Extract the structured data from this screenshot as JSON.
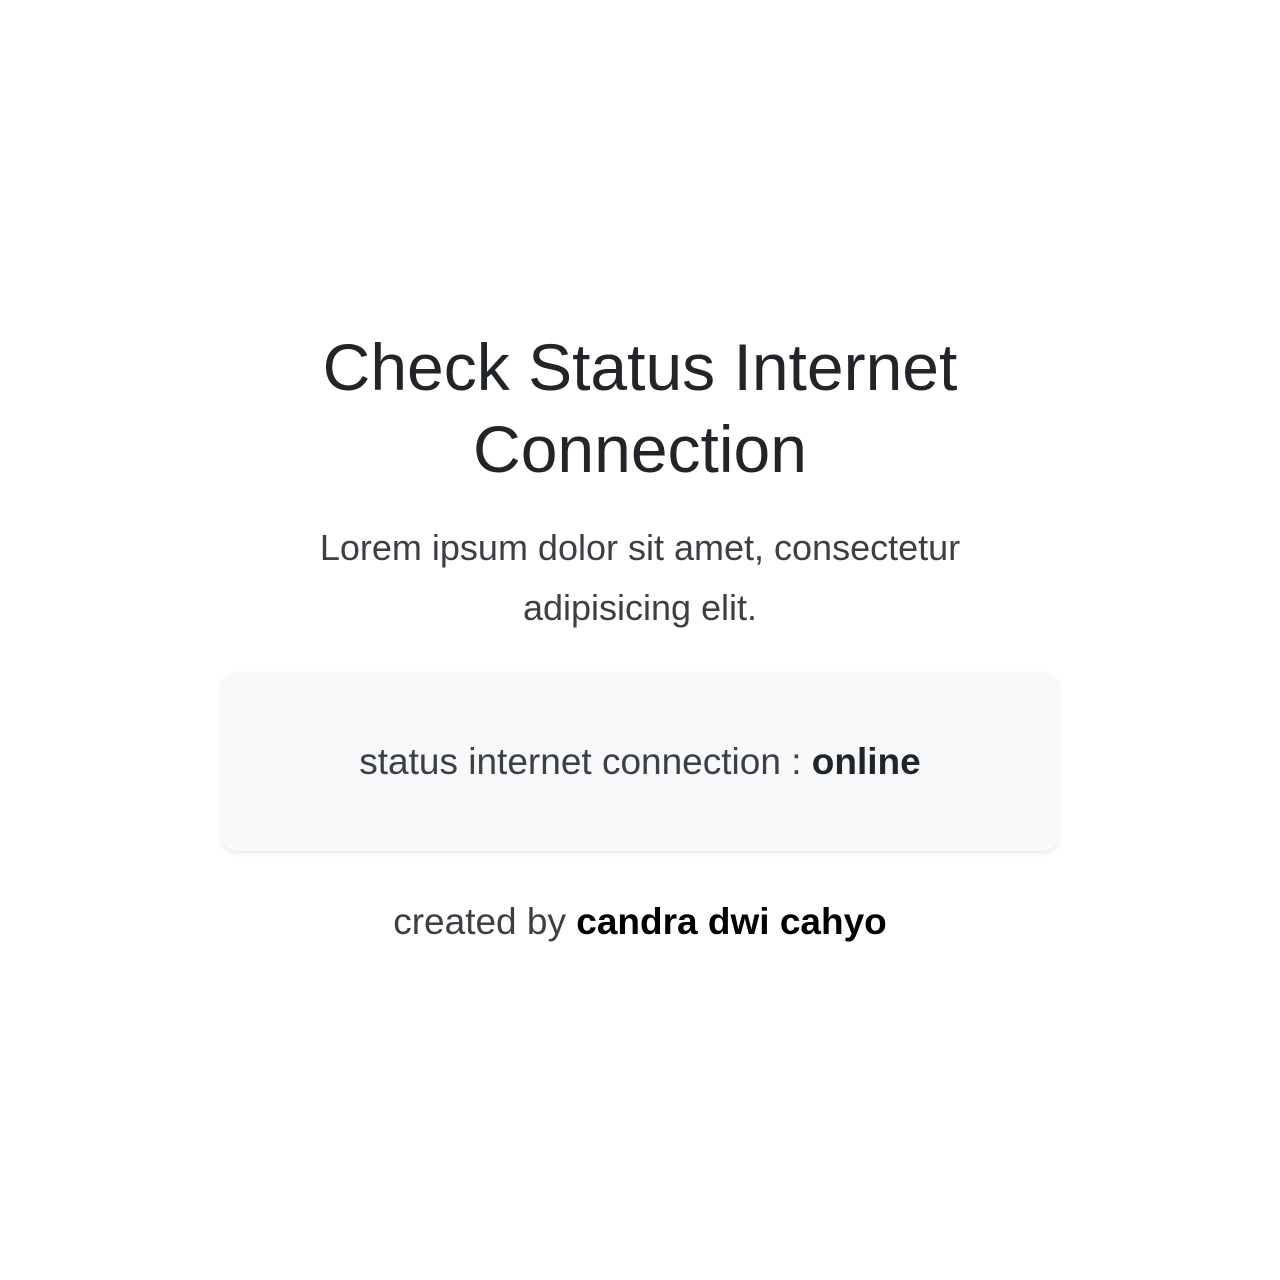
{
  "hero": {
    "title": "Check Status Internet Connection",
    "description": "Lorem ipsum dolor sit amet, consectetur adipisicing elit."
  },
  "status": {
    "label": "status internet connection : ",
    "value": "online"
  },
  "footer": {
    "prefix": "created by ",
    "author": "candra dwi cahyo"
  },
  "colors": {
    "background": "#ffffff",
    "card_background": "#f8f9fa",
    "text": "#212529",
    "muted_text": "#3c4045"
  }
}
